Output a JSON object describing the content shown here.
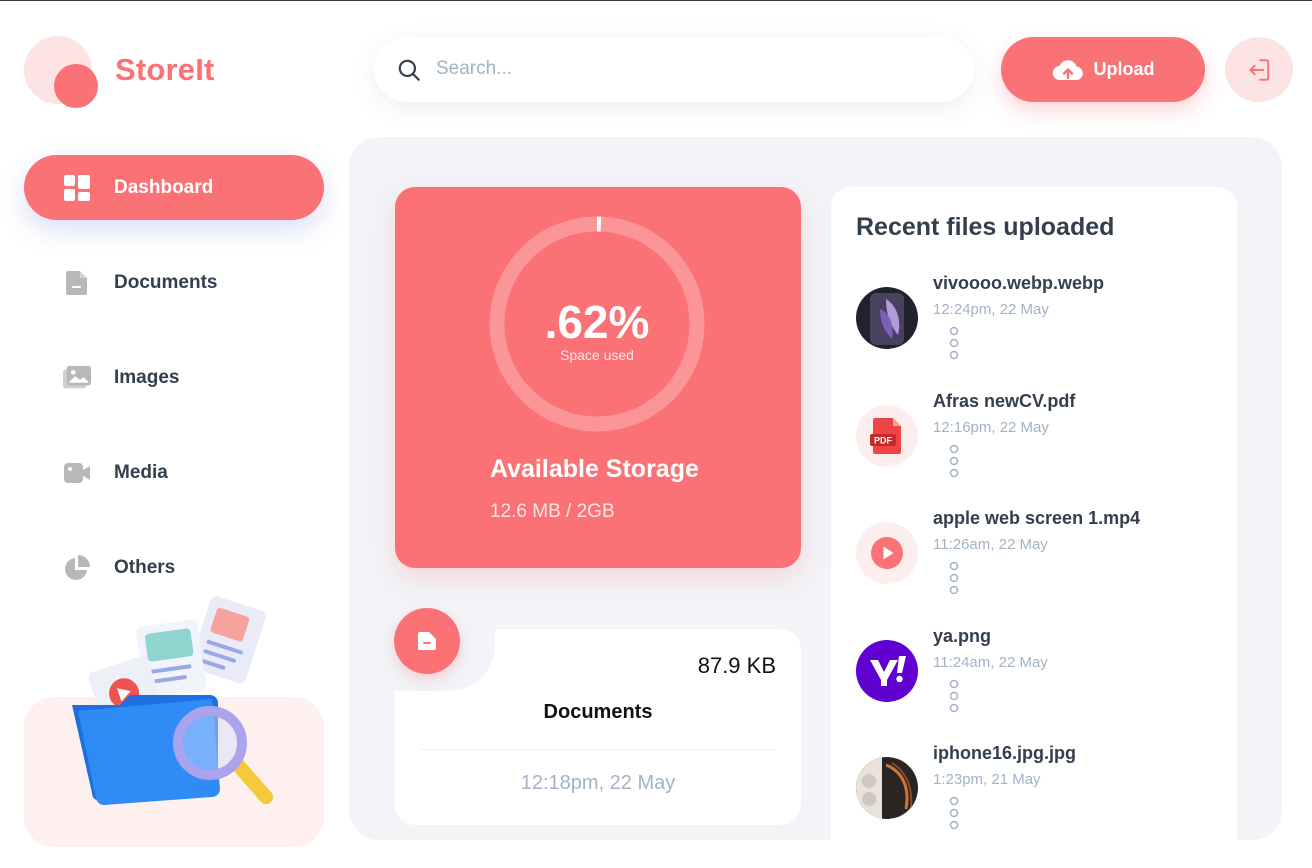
{
  "brand": {
    "name": "StoreIt",
    "accent": "#fa7275"
  },
  "header": {
    "search": {
      "placeholder": "Search..."
    },
    "upload_label": "Upload"
  },
  "sidebar": {
    "items": [
      {
        "label": "Dashboard",
        "icon": "dashboard-icon",
        "active": true
      },
      {
        "label": "Documents",
        "icon": "document-icon"
      },
      {
        "label": "Images",
        "icon": "images-icon"
      },
      {
        "label": "Media",
        "icon": "video-icon"
      },
      {
        "label": "Others",
        "icon": "pie-chart-icon"
      }
    ]
  },
  "storage": {
    "percent_label": ".62%",
    "percent_value": 0.62,
    "subtitle": "Space used",
    "title": "Available Storage",
    "value": "12.6 MB / 2GB"
  },
  "summary": {
    "size": "87.9 KB",
    "title": "Documents",
    "date": "12:18pm, 22 May"
  },
  "recent": {
    "title": "Recent files uploaded",
    "files": [
      {
        "name": "vivoooo.webp.webp",
        "date": "12:24pm, 22 May",
        "thumb": "phone-photo"
      },
      {
        "name": "Afras newCV.pdf",
        "date": "12:16pm, 22 May",
        "thumb": "pdf-icon"
      },
      {
        "name": "apple web screen 1.mp4",
        "date": "11:26am, 22 May",
        "thumb": "video-play-icon"
      },
      {
        "name": "ya.png",
        "date": "11:24am, 22 May",
        "thumb": "yahoo-logo"
      },
      {
        "name": "iphone16.jpg.jpg",
        "date": "1:23pm, 21 May",
        "thumb": "iphone-photo"
      }
    ]
  }
}
